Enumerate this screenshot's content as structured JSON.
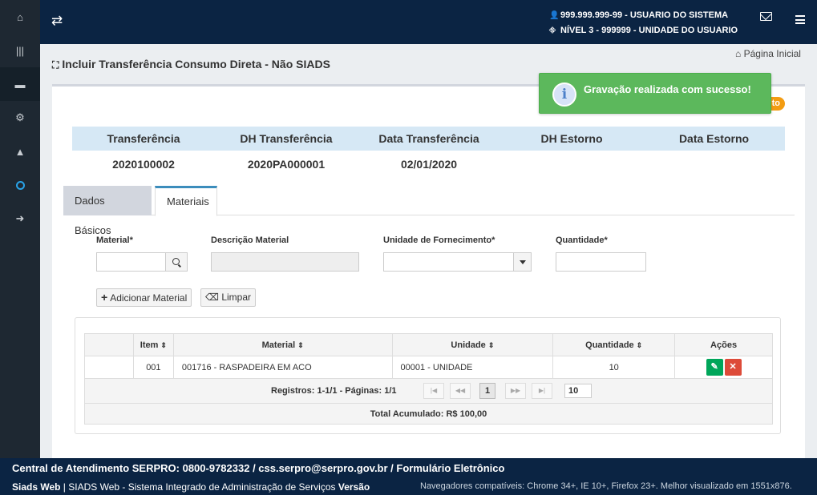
{
  "sidebar": {
    "items": [
      {
        "icon": "home-icon",
        "glyph": "⌂"
      },
      {
        "icon": "barcode-icon",
        "glyph": "|||"
      },
      {
        "icon": "archive-icon",
        "glyph": "▬"
      },
      {
        "icon": "cogs-icon",
        "glyph": "⚙"
      },
      {
        "icon": "graduation-cap-icon",
        "glyph": "▲"
      },
      {
        "icon": "circle-icon",
        "glyph": ""
      },
      {
        "icon": "sign-in-icon",
        "glyph": "➜"
      }
    ]
  },
  "header": {
    "user_line": "999.999.999-99 - USUARIO DO SISTEMA",
    "unit_line": "NÍVEL 3 - 999999 - UNIDADE DO USUARIO",
    "user_glyph": "👤",
    "unit_glyph": "⛗"
  },
  "page": {
    "title": "Incluir Transferência Consumo Direta - Não SIADS",
    "breadcrumb": "Página Inicial",
    "status_badge": "to"
  },
  "summary": {
    "headers": [
      "Transferência",
      "DH Transferência",
      "Data Transferência",
      "DH Estorno",
      "Data Estorno"
    ],
    "values": [
      "2020100002",
      "2020PA000001",
      "02/01/2020",
      "",
      ""
    ]
  },
  "tabs": [
    {
      "label": "Dados Básicos",
      "active": false
    },
    {
      "label": "Materiais",
      "active": true
    }
  ],
  "form": {
    "material_label": "Material*",
    "material_value": "",
    "descricao_label": "Descrição Material",
    "descricao_value": "",
    "unidade_label": "Unidade de Fornecimento*",
    "unidade_value": "",
    "quantidade_label": "Quantidade*",
    "quantidade_value": ""
  },
  "buttons": {
    "add_material": "Adicionar Material",
    "clear": "Limpar"
  },
  "table": {
    "columns": [
      "",
      "Item",
      "Material",
      "Unidade",
      "Quantidade",
      "Ações"
    ],
    "rows": [
      {
        "item": "001",
        "material": "001716 - RASPADEIRA EM ACO",
        "unidade": "00001 - UNIDADE",
        "quantidade": "10"
      }
    ],
    "pager_text": "Registros: 1-1/1 - Páginas: 1/1",
    "current_page": "1",
    "rows_per_page": "10",
    "total": "Total Acumulado: R$ 100,00"
  },
  "toast": {
    "message": "Gravação realizada com sucesso!"
  },
  "footer": {
    "contact": "Central de Atendimento SERPRO: 0800-9782332 / css.serpro@serpro.gov.br / Formulário Eletrônico",
    "app_name": "Siads Web",
    "app_desc": " | SIADS Web - Sistema Integrado de Administração de Serviços ",
    "version_label": "Versão",
    "browsers": "Navegadores compatíveis: Chrome 34+, IE 10+, Firefox 23+. Melhor visualizado em 1551x876."
  },
  "colors": {
    "header_bg": "#0b2443",
    "sidebar_bg": "#1e2832",
    "toast_bg": "#5cb85c",
    "badge_bg": "#f39c12",
    "summary_bg": "#d6e8f5"
  }
}
